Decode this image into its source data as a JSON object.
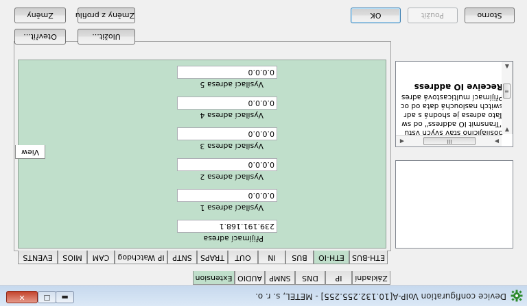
{
  "window": {
    "title": "Device configuration VoIP-A[10.132.255.255] - METEL, s. r. o.",
    "controls": {
      "minimize": "▬",
      "maximize": "☐",
      "close": "✕"
    },
    "app_icon": "gear-icon"
  },
  "outer_tabs": [
    "Základní",
    "IP",
    "DNS",
    "SNMP",
    "AUDIO",
    "Extension"
  ],
  "outer_active": "Extension",
  "inner_tabs": [
    "ETH-BUS",
    "ETH-IO",
    "BUS",
    "IN",
    "OUT",
    "TRAPS",
    "SNTP",
    "IP Watchdog",
    "CAM",
    "MIOS",
    "EVENTS"
  ],
  "inner_active": "ETH-IO",
  "fields": [
    {
      "label": "Přijímací adresa",
      "value": "239.191.168.1"
    },
    {
      "label": "Vysílací adresa 1",
      "value": "0.0.0.0"
    },
    {
      "label": "Vysílací adresa 2",
      "value": "0.0.0.0"
    },
    {
      "label": "Vysílací adresa 3",
      "value": "0.0.0.0"
    },
    {
      "label": "Vysílací adresa 4",
      "value": "0.0.0.0"
    },
    {
      "label": "Vysílací adresa 5",
      "value": "0.0.0.0"
    }
  ],
  "help": {
    "tab": "View",
    "title": "Receive IO address",
    "lines": [
      "Přijímací multicastová adres",
      "switch naslouchá data od oc",
      "Tato adresa je shodná s adr",
      "\"Transmit IO address\" od sw",
      "posílajícího stav svých vstu"
    ],
    "hscroll_grip": "III",
    "vscroll_grip": "≡"
  },
  "buttons": {
    "zmeny": "Změny",
    "zmeny_profil": "Změny z profilu",
    "otevrit": "Otevřít...",
    "ulozit": "Uložit...",
    "ok": "OK",
    "pouzit": "Použít",
    "storno": "Storno"
  }
}
